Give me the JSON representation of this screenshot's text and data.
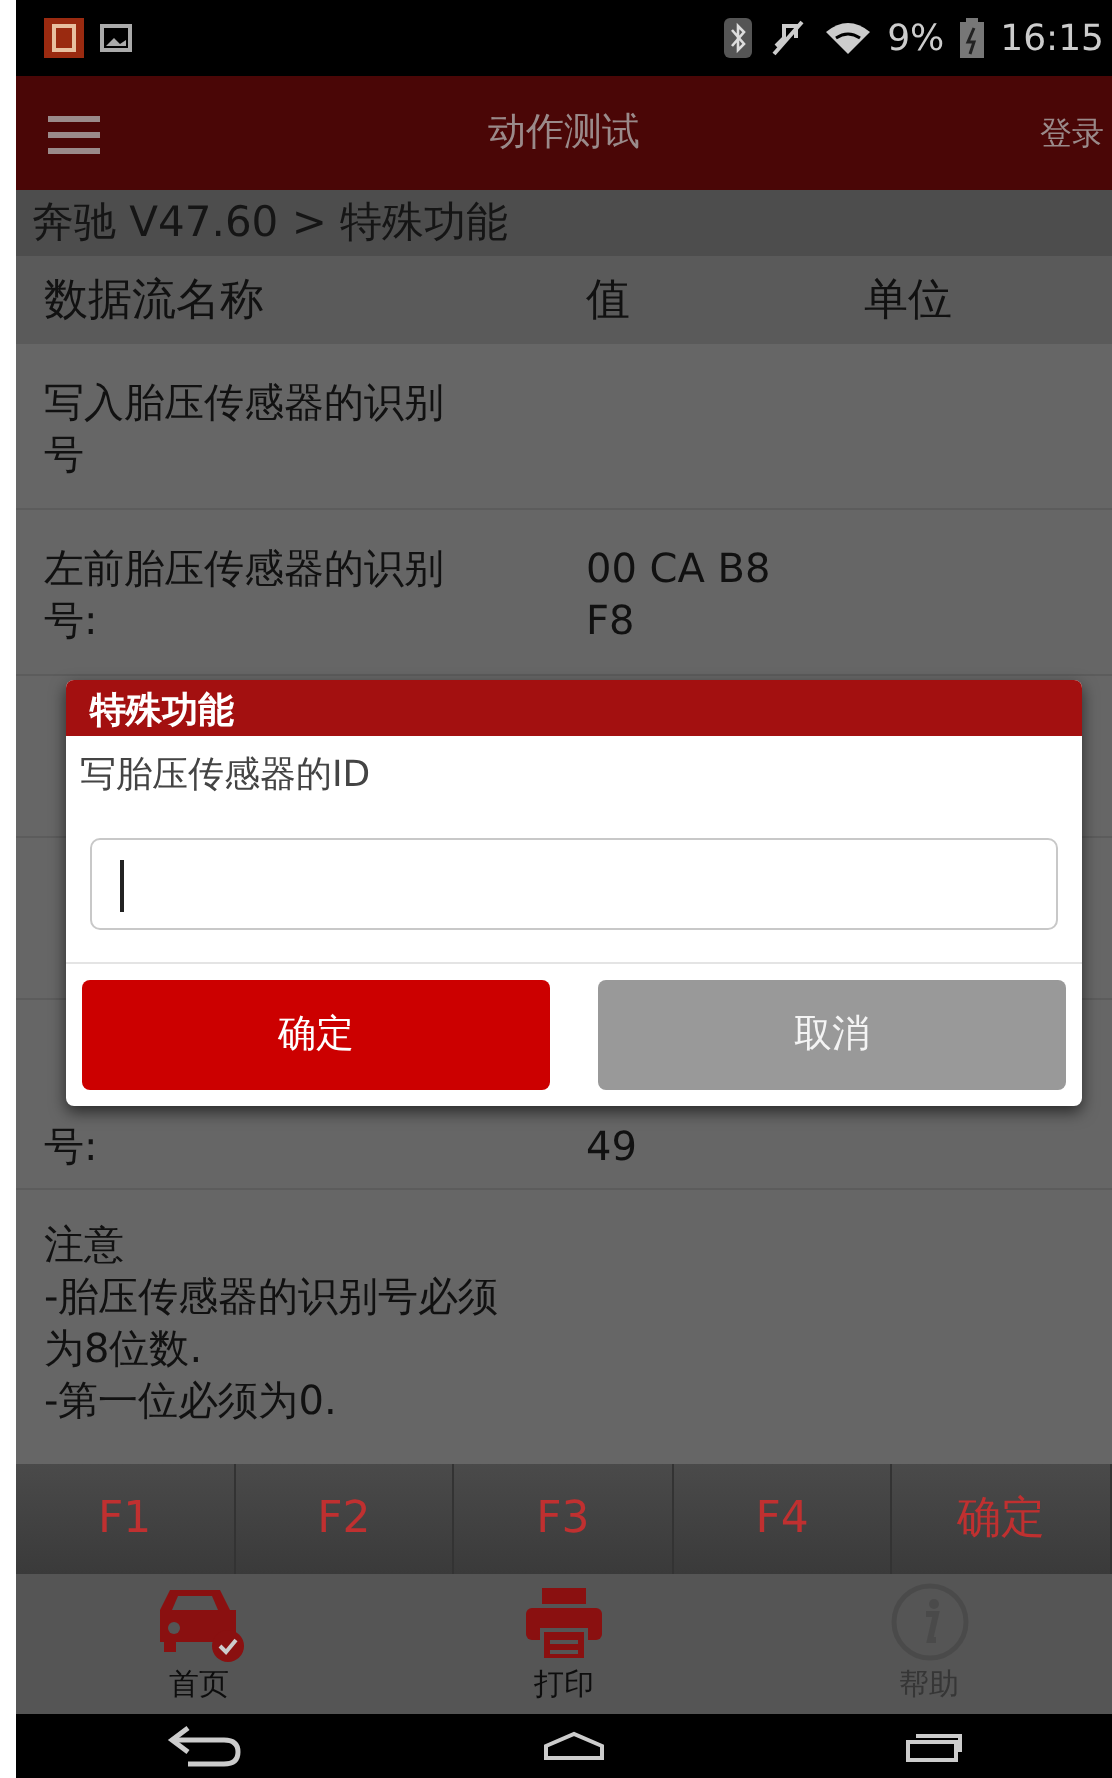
{
  "status_bar": {
    "battery": "9%",
    "time": "16:15"
  },
  "app_bar": {
    "title": "动作测试",
    "action": "登录"
  },
  "breadcrumb": "奔驰 V47.60 > 特殊功能",
  "table": {
    "columns": [
      "数据流名称",
      "值",
      "单位"
    ],
    "rows": [
      {
        "kind": "full",
        "name": "写入胎压传感器的识别号"
      },
      {
        "kind": "full",
        "name": "左前胎压传感器的识别号:",
        "value": "00 CA B8 F8"
      },
      {
        "kind": "covered"
      },
      {
        "kind": "covered"
      },
      {
        "kind": "covered",
        "name": "号:",
        "value": "49"
      }
    ]
  },
  "note": [
    "注意",
    "-胎压传感器的识别号必须为8位数.",
    "-第一位必须为0."
  ],
  "function_keys": [
    "F1",
    "F2",
    "F3",
    "F4",
    "确定"
  ],
  "nav": [
    {
      "label": "首页",
      "kind": "car",
      "disabled": false
    },
    {
      "label": "打印",
      "kind": "printer",
      "disabled": false
    },
    {
      "label": "帮助",
      "kind": "info",
      "disabled": true
    }
  ],
  "dialog": {
    "title": "特殊功能",
    "prompt": "写胎压传感器的ID",
    "buttons": [
      {
        "label": "确定",
        "kind": "primary"
      },
      {
        "label": "取消",
        "kind": "secondary"
      }
    ]
  }
}
